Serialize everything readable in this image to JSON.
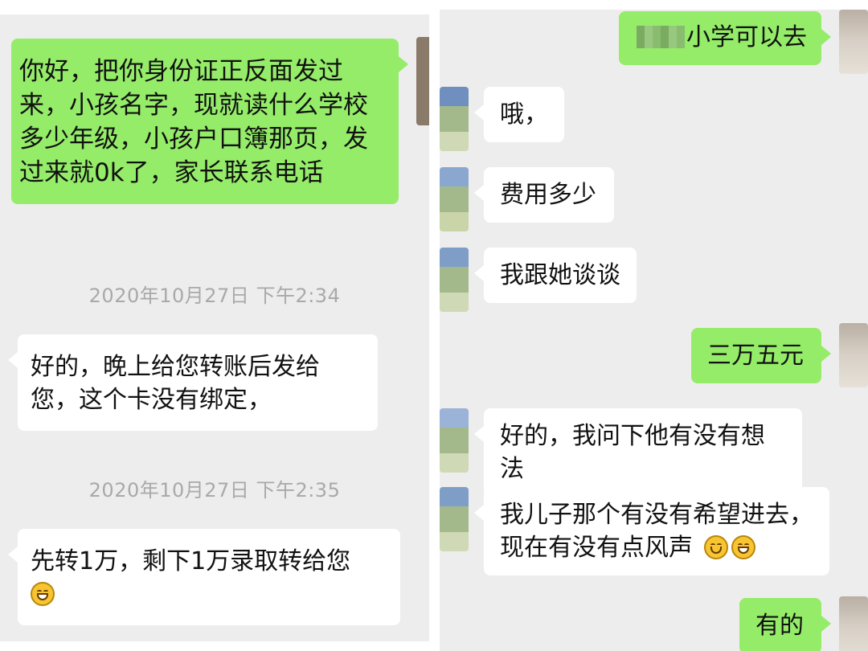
{
  "left": {
    "messages": [
      {
        "text": "你好，把你身份证正反面发过来，小孩名字，现就读什么学校多少年级，小孩户口簿那页，发过来就0k了，家长联系电话"
      },
      {
        "text": "好的，晚上给您转账后发给您，这个卡没有绑定，"
      },
      {
        "text": "先转1万，剩下1万录取转给您"
      }
    ],
    "timestamps": [
      "2020年10月27日 下午2:34",
      "2020年10月27日 下午2:35"
    ],
    "emoji": [
      "grin-emoji"
    ]
  },
  "right": {
    "messages": [
      {
        "text": "小学可以去"
      },
      {
        "text": "哦，"
      },
      {
        "text": "费用多少"
      },
      {
        "text": "我跟她谈谈"
      },
      {
        "text": "三万五元"
      },
      {
        "text": "好的，我问下他有没有想法"
      },
      {
        "text": "我儿子那个有没有希望进去，现在有没有点风声"
      },
      {
        "text": "有的"
      }
    ],
    "emoji": [
      "smile-emoji",
      "grin-emoji"
    ]
  },
  "colors": {
    "sent_bubble": "#95ec69",
    "received_bubble": "#ffffff",
    "chat_background": "#ededed",
    "timestamp": "#a9a9a9"
  }
}
